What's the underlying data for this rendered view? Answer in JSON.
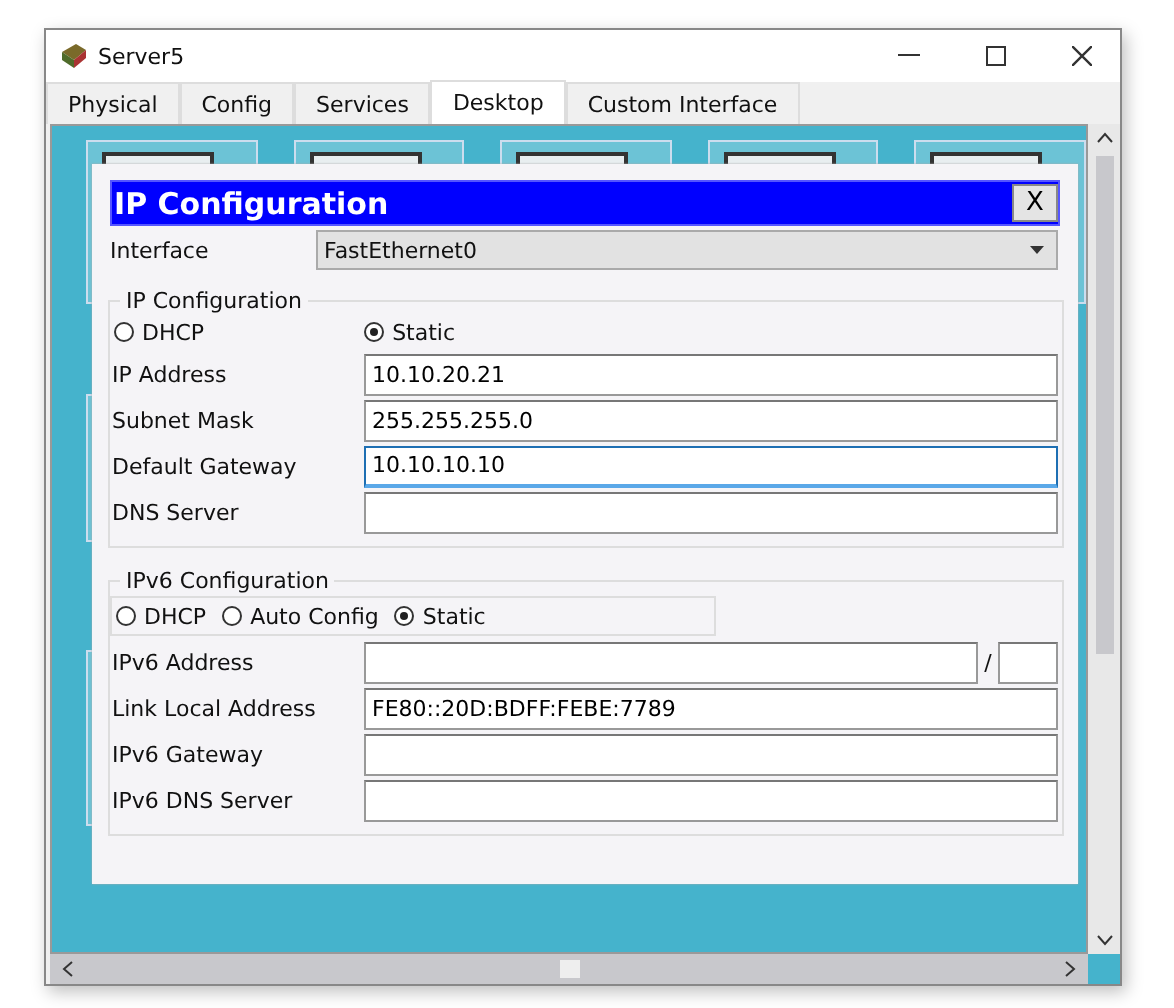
{
  "window": {
    "title": "Server5"
  },
  "tabs": [
    {
      "label": "Physical",
      "selected": false
    },
    {
      "label": "Config",
      "selected": false
    },
    {
      "label": "Services",
      "selected": false
    },
    {
      "label": "Desktop",
      "selected": true
    },
    {
      "label": "Custom Interface",
      "selected": false
    }
  ],
  "dialog": {
    "title": "IP Configuration",
    "close": "X",
    "interface_label": "Interface",
    "interface_value": "FastEthernet0",
    "ipv4": {
      "legend": "IP Configuration",
      "modes": [
        {
          "label": "DHCP",
          "selected": false
        },
        {
          "label": "Static",
          "selected": true
        }
      ],
      "fields": [
        {
          "label": "IP Address",
          "value": "10.10.20.21",
          "focused": false
        },
        {
          "label": "Subnet Mask",
          "value": "255.255.255.0",
          "focused": false
        },
        {
          "label": "Default Gateway",
          "value": "10.10.10.10",
          "focused": true
        },
        {
          "label": "DNS Server",
          "focused": false
        }
      ]
    },
    "ipv6": {
      "legend": "IPv6 Configuration",
      "modes": [
        {
          "label": "DHCP",
          "selected": false
        },
        {
          "label": "Auto Config",
          "selected": false
        },
        {
          "label": "Static",
          "selected": true
        }
      ],
      "prefix_separator": "/",
      "fields": [
        {
          "label": "IPv6 Address",
          "kind": "prefixed",
          "focused": false
        },
        {
          "label": "Link Local Address",
          "value": "FE80::20D:BDFF:FEBE:7789",
          "kind": "plain",
          "focused": false
        },
        {
          "label": "IPv6 Gateway",
          "kind": "plain",
          "focused": false
        },
        {
          "label": "IPv6 DNS Server",
          "kind": "plain",
          "focused": false
        }
      ]
    }
  }
}
